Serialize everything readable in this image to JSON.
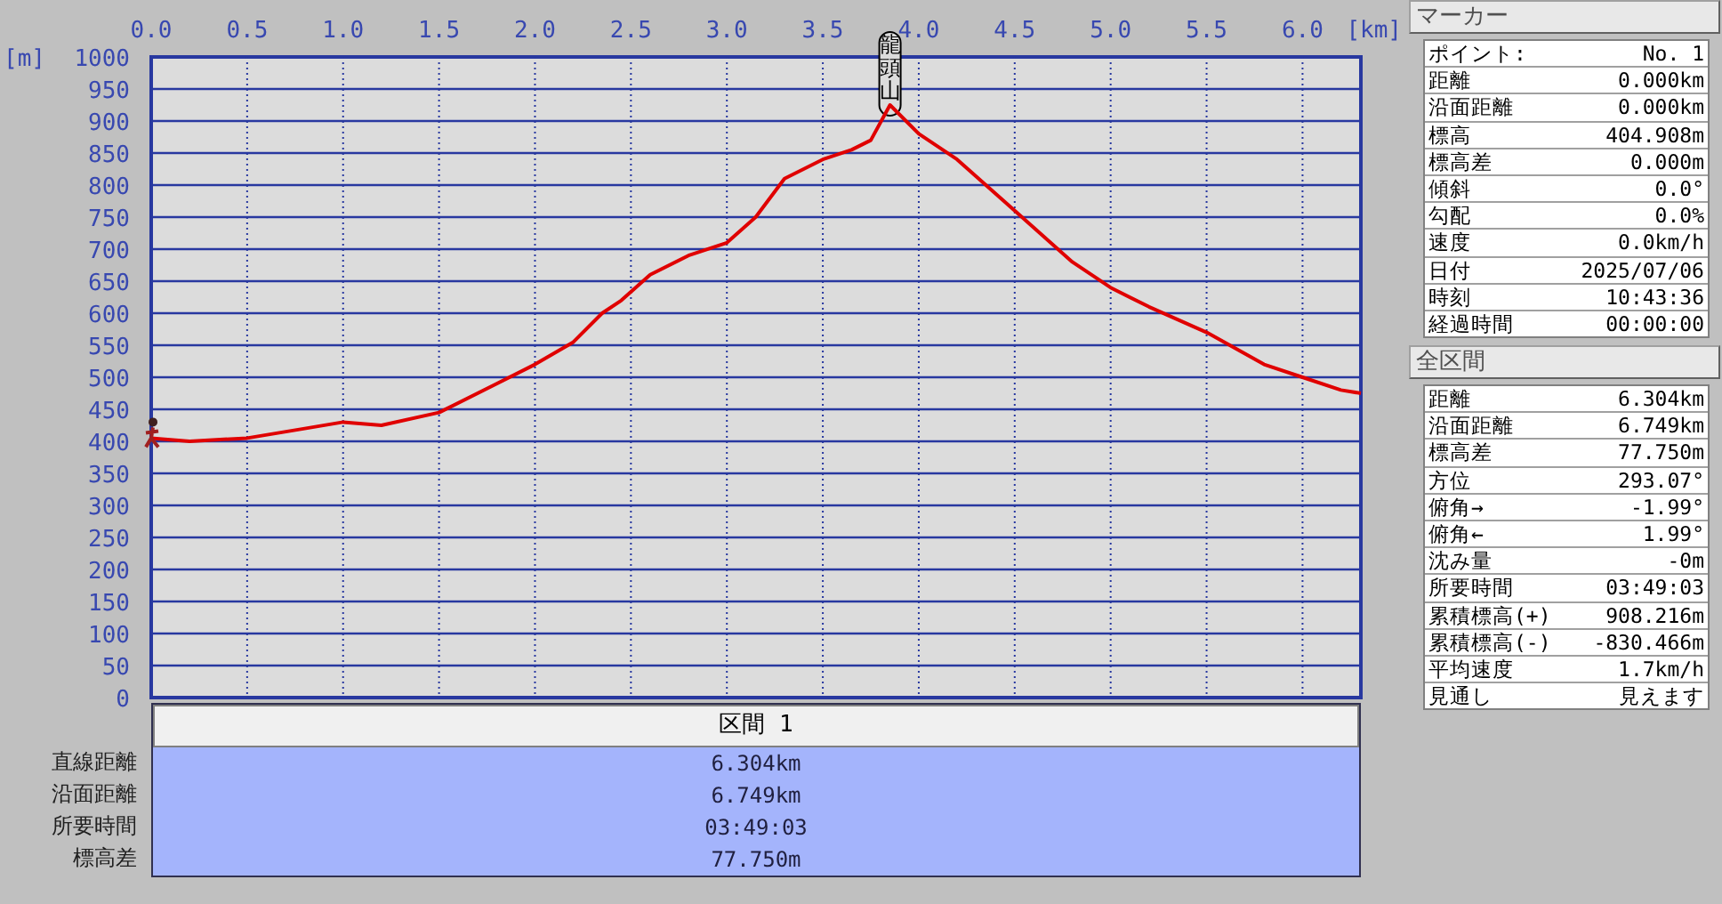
{
  "chart": {
    "chart_data": {
      "type": "line",
      "xlabel": "[km]",
      "ylabel": "[m]",
      "x": [
        0,
        0.2,
        0.5,
        0.8,
        1.0,
        1.2,
        1.5,
        1.8,
        2.0,
        2.2,
        2.35,
        2.45,
        2.6,
        2.8,
        3.0,
        3.15,
        3.3,
        3.5,
        3.65,
        3.75,
        3.85,
        4.0,
        4.2,
        4.5,
        4.8,
        5.0,
        5.2,
        5.5,
        5.8,
        6.0,
        6.2,
        6.304
      ],
      "grid": true,
      "series": [
        {
          "color": "#e00000",
          "values": [
            405,
            400,
            405,
            420,
            430,
            425,
            445,
            490,
            520,
            555,
            600,
            620,
            660,
            690,
            710,
            750,
            810,
            840,
            855,
            870,
            925,
            880,
            840,
            760,
            680,
            640,
            610,
            570,
            520,
            500,
            480,
            475
          ]
        }
      ],
      "xlim": [
        0,
        6.304
      ],
      "ylim": [
        0,
        1000
      ],
      "xticks": [
        {
          "value": 0,
          "label": "0.0"
        },
        {
          "value": 0.5,
          "label": "0.5"
        },
        {
          "value": 1,
          "label": "1.0"
        },
        {
          "value": 1.5,
          "label": "1.5"
        },
        {
          "value": 2,
          "label": "2.0"
        },
        {
          "value": 2.5,
          "label": "2.5"
        },
        {
          "value": 3,
          "label": "3.0"
        },
        {
          "value": 3.5,
          "label": "3.5"
        },
        {
          "value": 4,
          "label": "4.0"
        },
        {
          "value": 4.5,
          "label": "4.5"
        },
        {
          "value": 5,
          "label": "5.0"
        },
        {
          "value": 5.5,
          "label": "5.5"
        },
        {
          "value": 6,
          "label": "6.0"
        }
      ],
      "yticks": [
        0,
        50,
        100,
        150,
        200,
        250,
        300,
        350,
        400,
        450,
        500,
        550,
        600,
        650,
        700,
        750,
        800,
        850,
        900,
        950,
        1000
      ],
      "annotations": [
        {
          "x": 3.85,
          "y": 925,
          "text": "龍頭山"
        }
      ]
    }
  },
  "section": {
    "header": "区間 1",
    "rows": [
      {
        "label": "直線距離",
        "value": "6.304km"
      },
      {
        "label": "沿面距離",
        "value": "6.749km"
      },
      {
        "label": "所要時間",
        "value": "03:49:03"
      },
      {
        "label": "標高差",
        "value": "77.750m"
      }
    ]
  },
  "marker_panel": {
    "title": "マーカー",
    "rows": [
      {
        "label": "ポイント:",
        "value": "No. 1"
      },
      {
        "label": "距離",
        "value": "0.000km"
      },
      {
        "label": "沿面距離",
        "value": "0.000km"
      },
      {
        "label": "標高",
        "value": "404.908m"
      },
      {
        "label": "標高差",
        "value": "0.000m"
      },
      {
        "label": "傾斜",
        "value": "0.0°"
      },
      {
        "label": "勾配",
        "value": "0.0%"
      },
      {
        "label": "速度",
        "value": "0.0km/h"
      },
      {
        "label": "日付",
        "value": "2025/07/06"
      },
      {
        "label": "時刻",
        "value": "10:43:36"
      },
      {
        "label": "経過時間",
        "value": "00:00:00"
      }
    ]
  },
  "total_panel": {
    "title": "全区間",
    "rows": [
      {
        "label": "距離",
        "value": "6.304km"
      },
      {
        "label": "沿面距離",
        "value": "6.749km"
      },
      {
        "label": "標高差",
        "value": "77.750m"
      },
      {
        "label": "方位",
        "value": "293.07°"
      },
      {
        "label": "俯角→",
        "value": "-1.99°"
      },
      {
        "label": "俯角←",
        "value": "1.99°"
      },
      {
        "label": "沈み量",
        "value": "-0m"
      },
      {
        "label": "所要時間",
        "value": "03:49:03"
      },
      {
        "label": "累積標高(+)",
        "value": "908.216m"
      },
      {
        "label": "累積標高(-)",
        "value": "-830.466m"
      },
      {
        "label": "平均速度",
        "value": "1.7km/h"
      },
      {
        "label": "見通し",
        "value": "見えます"
      }
    ]
  }
}
